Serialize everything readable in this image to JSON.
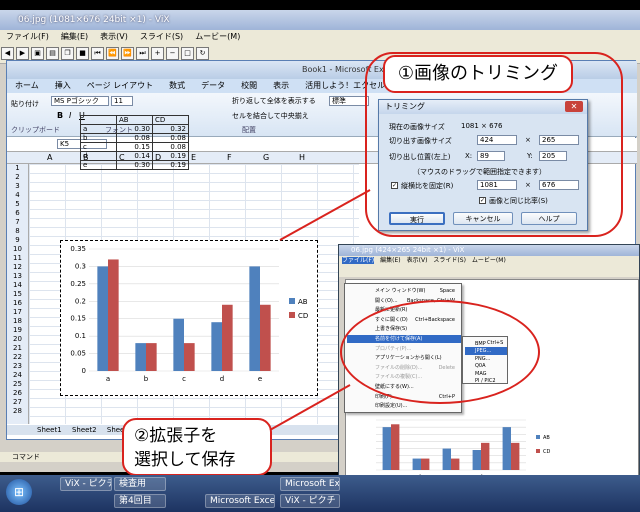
{
  "vix": {
    "title": "06.jpg (1081×676 24bit ×1) - ViX",
    "menu": [
      "ファイル(F)",
      "編集(E)",
      "表示(V)",
      "スライド(S)",
      "ムービー(M)"
    ],
    "status": "コマンド"
  },
  "excel": {
    "title": "Book1 - Microsoft Excel",
    "tabs": [
      "ホーム",
      "挿入",
      "ページ レイアウト",
      "数式",
      "データ",
      "校閲",
      "表示",
      "活用しよう！エクセル"
    ],
    "paste_label": "貼り付け",
    "clipboard": "クリップボード",
    "font_group": "フォント",
    "align_group": "配置",
    "font_name": "MS Pゴシック",
    "font_size": "11",
    "wrap": "折り返して全体を表示する",
    "merge": "セルを結合して中央揃え",
    "numfmt": "標準",
    "cellref": "K5",
    "cols": [
      "A",
      "B",
      "C",
      "D",
      "E",
      "F",
      "G",
      "H"
    ],
    "rows": [
      "1",
      "2",
      "3",
      "4",
      "5",
      "6",
      "7",
      "8",
      "9",
      "10",
      "11",
      "12",
      "13",
      "14",
      "15",
      "16",
      "17",
      "18",
      "19",
      "20",
      "21",
      "22",
      "23",
      "24",
      "25",
      "26",
      "27",
      "28"
    ],
    "table": {
      "headers": [
        "",
        "AB",
        "CD"
      ],
      "rows": [
        [
          "a",
          "0.30",
          "0.32"
        ],
        [
          "b",
          "0.08",
          "0.08"
        ],
        [
          "c",
          "0.15",
          "0.08"
        ],
        [
          "d",
          "0.14",
          "0.19"
        ],
        [
          "e",
          "0.30",
          "0.19"
        ]
      ]
    },
    "sheets": [
      "Sheet1",
      "Sheet2",
      "Sheet3"
    ]
  },
  "chart_data": {
    "type": "bar",
    "categories": [
      "a",
      "b",
      "c",
      "d",
      "e"
    ],
    "series": [
      {
        "name": "AB",
        "values": [
          0.3,
          0.08,
          0.15,
          0.14,
          0.3
        ]
      },
      {
        "name": "CD",
        "values": [
          0.32,
          0.08,
          0.08,
          0.19,
          0.19
        ]
      }
    ],
    "yticks": [
      "0",
      "0.05",
      "0.1",
      "0.15",
      "0.2",
      "0.25",
      "0.3",
      "0.35"
    ],
    "ylim": [
      0,
      0.35
    ],
    "legend": "right",
    "colors": [
      "#4f81bd",
      "#c0504d"
    ]
  },
  "trim": {
    "title": "トリミング",
    "current_size_label": "現在の画像サイズ",
    "current_size": "1081 × 676",
    "cut_size_label": "切り出す画像サイズ",
    "w": "424",
    "x": "×",
    "h": "265",
    "pos_label": "切り出し位置(左上)",
    "xl": "X:",
    "xv": "89",
    "yl": "Y:",
    "yv": "205",
    "hint": "（マウスのドラッグで範囲指定できます）",
    "keep_ratio": "縦横比を固定(R)",
    "rw": "1081",
    "rh": "676",
    "same_ratio": "画像と同じ比率(S)",
    "ok": "実行",
    "cancel": "キャンセル",
    "help": "ヘルプ"
  },
  "vix2": {
    "title": "06.jpg (424×265 24bit ×1) - ViX",
    "menu": [
      "ファイル(F)",
      "編集(E)",
      "表示(V)",
      "スライド(S)",
      "ムービー(M)"
    ]
  },
  "filemenu": {
    "items": [
      {
        "l": "メイン ウィンドウ(W)",
        "s": "Space"
      },
      {
        "l": "開く(O)...",
        "s": "Backspace, Ctrl+W"
      },
      {
        "l": "最新に更新(R)",
        "s": ""
      },
      {
        "l": "すぐに開く(D)",
        "s": "Ctrl+Backspace"
      },
      {
        "l": "上書き保存(S)",
        "s": ""
      },
      {
        "l": "名前を付けて保存(A)",
        "s": ""
      },
      {
        "l": "プロパティ(P)...",
        "s": ""
      },
      {
        "l": "アプリケーションから開く(L)",
        "s": ""
      },
      {
        "l": "ファイルの削除(D)...",
        "s": "Delete"
      },
      {
        "l": "ファイルの複製(C)...",
        "s": ""
      },
      {
        "l": "壁紙にする(W)...",
        "s": ""
      },
      {
        "l": "印刷(P)...",
        "s": "Ctrl+P"
      },
      {
        "l": "印刷設定(U)...",
        "s": ""
      }
    ],
    "sub": [
      "BMP",
      "JPEG...",
      "PNG...",
      "Q0A",
      "MAG",
      "PI / PIC2"
    ],
    "sub_shortcut": "Ctrl+S"
  },
  "callouts": {
    "c1": "①画像のトリミング",
    "c2a": "②拡張子を",
    "c2b": "選択して保存"
  },
  "taskbar": {
    "items": [
      "ViX - ピクチ",
      "検査用",
      "第4回目",
      "Microsoft Excel",
      "Microsoft Excel",
      "ViX - ピクチ"
    ]
  }
}
